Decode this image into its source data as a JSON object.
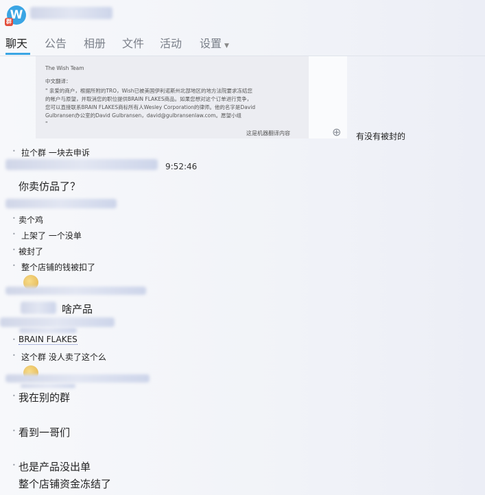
{
  "tabs": [
    {
      "label": "聊天",
      "active": true
    },
    {
      "label": "公告"
    },
    {
      "label": "相册"
    },
    {
      "label": "文件"
    },
    {
      "label": "活动"
    },
    {
      "label": "设置"
    }
  ],
  "card": {
    "team": "The Wish Team",
    "heading": "中文翻译：",
    "body_lines": [
      "\" 亲爱的商户，根据所附的TRO，Wish已被美国伊利诺斯州北部地区的地方法院要求冻结您",
      "的帐户与原望，并取消您的职位提供BRAIN FLAKES商品。如果您想对这个订单进行竞争，",
      "您可以直接联系BRAIN FLAKES商标所有人Wesley Corporation的律师。他的名字是David",
      "Gulbransen办公室的David Gulbransen，david@gulbransenlaw.com。愿望小组",
      "\""
    ],
    "footer": "这是机器翻译内容"
  },
  "side_message": "有没有被封的",
  "messages": {
    "m1": "拉个群  一块去申诉",
    "time1": "9:52:46",
    "m2": "你卖仿品了？",
    "m3": "卖个鸡",
    "m4": "上架了  一个没单",
    "m5": "被封了",
    "m6": "整个店铺的钱被扣了",
    "m7": "啥产品",
    "m8": "BRAIN FLAKES",
    "m9": "这个群 没人卖了这个么",
    "m10": "我在别的群",
    "m11": "看到一哥们",
    "m12": "也是产品没出单",
    "m13": "整个店铺资金冻结了"
  },
  "colors": {
    "accent": "#3aa5e4",
    "logo_badge": "#e24c3a"
  }
}
